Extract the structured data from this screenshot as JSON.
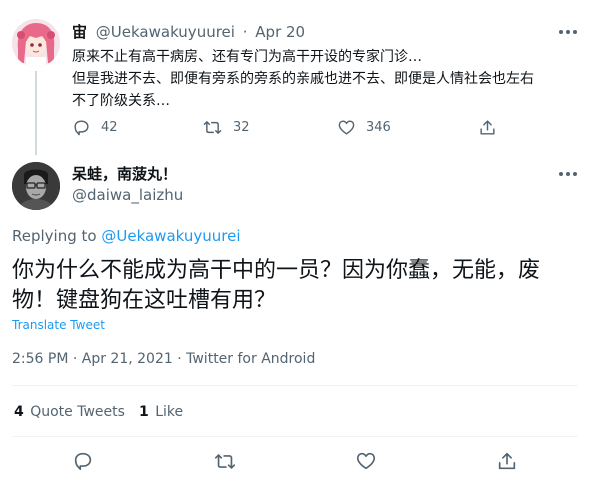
{
  "parent_tweet": {
    "display_name": "宙",
    "handle": "@Uekawakuyuurei",
    "separator": "·",
    "date": "Apr 20",
    "lines": [
      "原来不止有高干病房、还有专门为高干开设的专家门诊…",
      "但是我进不去、即便有旁系的旁系的亲戚也进不去、即便是人情社会也左右",
      "不了阶级关系…"
    ],
    "reply_count": "42",
    "retweet_count": "32",
    "like_count": "346"
  },
  "main_tweet": {
    "display_name": "呆蛙，南菠丸！",
    "handle": "@daiwa_laizhu",
    "replying_prefix": "Replying to",
    "replying_to": "@Uekawakuyuurei",
    "text_lines": [
      "你为什么不能成为高干中的一员？因为你蠢，无能，废",
      "物！键盘狗在这吐槽有用？"
    ],
    "translate_label": "Translate Tweet",
    "timestamp": "2:56 PM · Apr 21, 2021 · Twitter for Android",
    "quote_count": "4",
    "quote_label": "Quote Tweets",
    "like_count": "1",
    "like_label": "Like"
  },
  "icons": {
    "more": "more-dots-icon",
    "reply": "reply-bubble-icon",
    "retweet": "retweet-arrows-icon",
    "like": "heart-icon",
    "share": "share-upload-icon"
  },
  "colors": {
    "accent": "#1d9bf0",
    "muted": "#536471",
    "text": "#0f1419",
    "divider": "#eff3f4"
  }
}
